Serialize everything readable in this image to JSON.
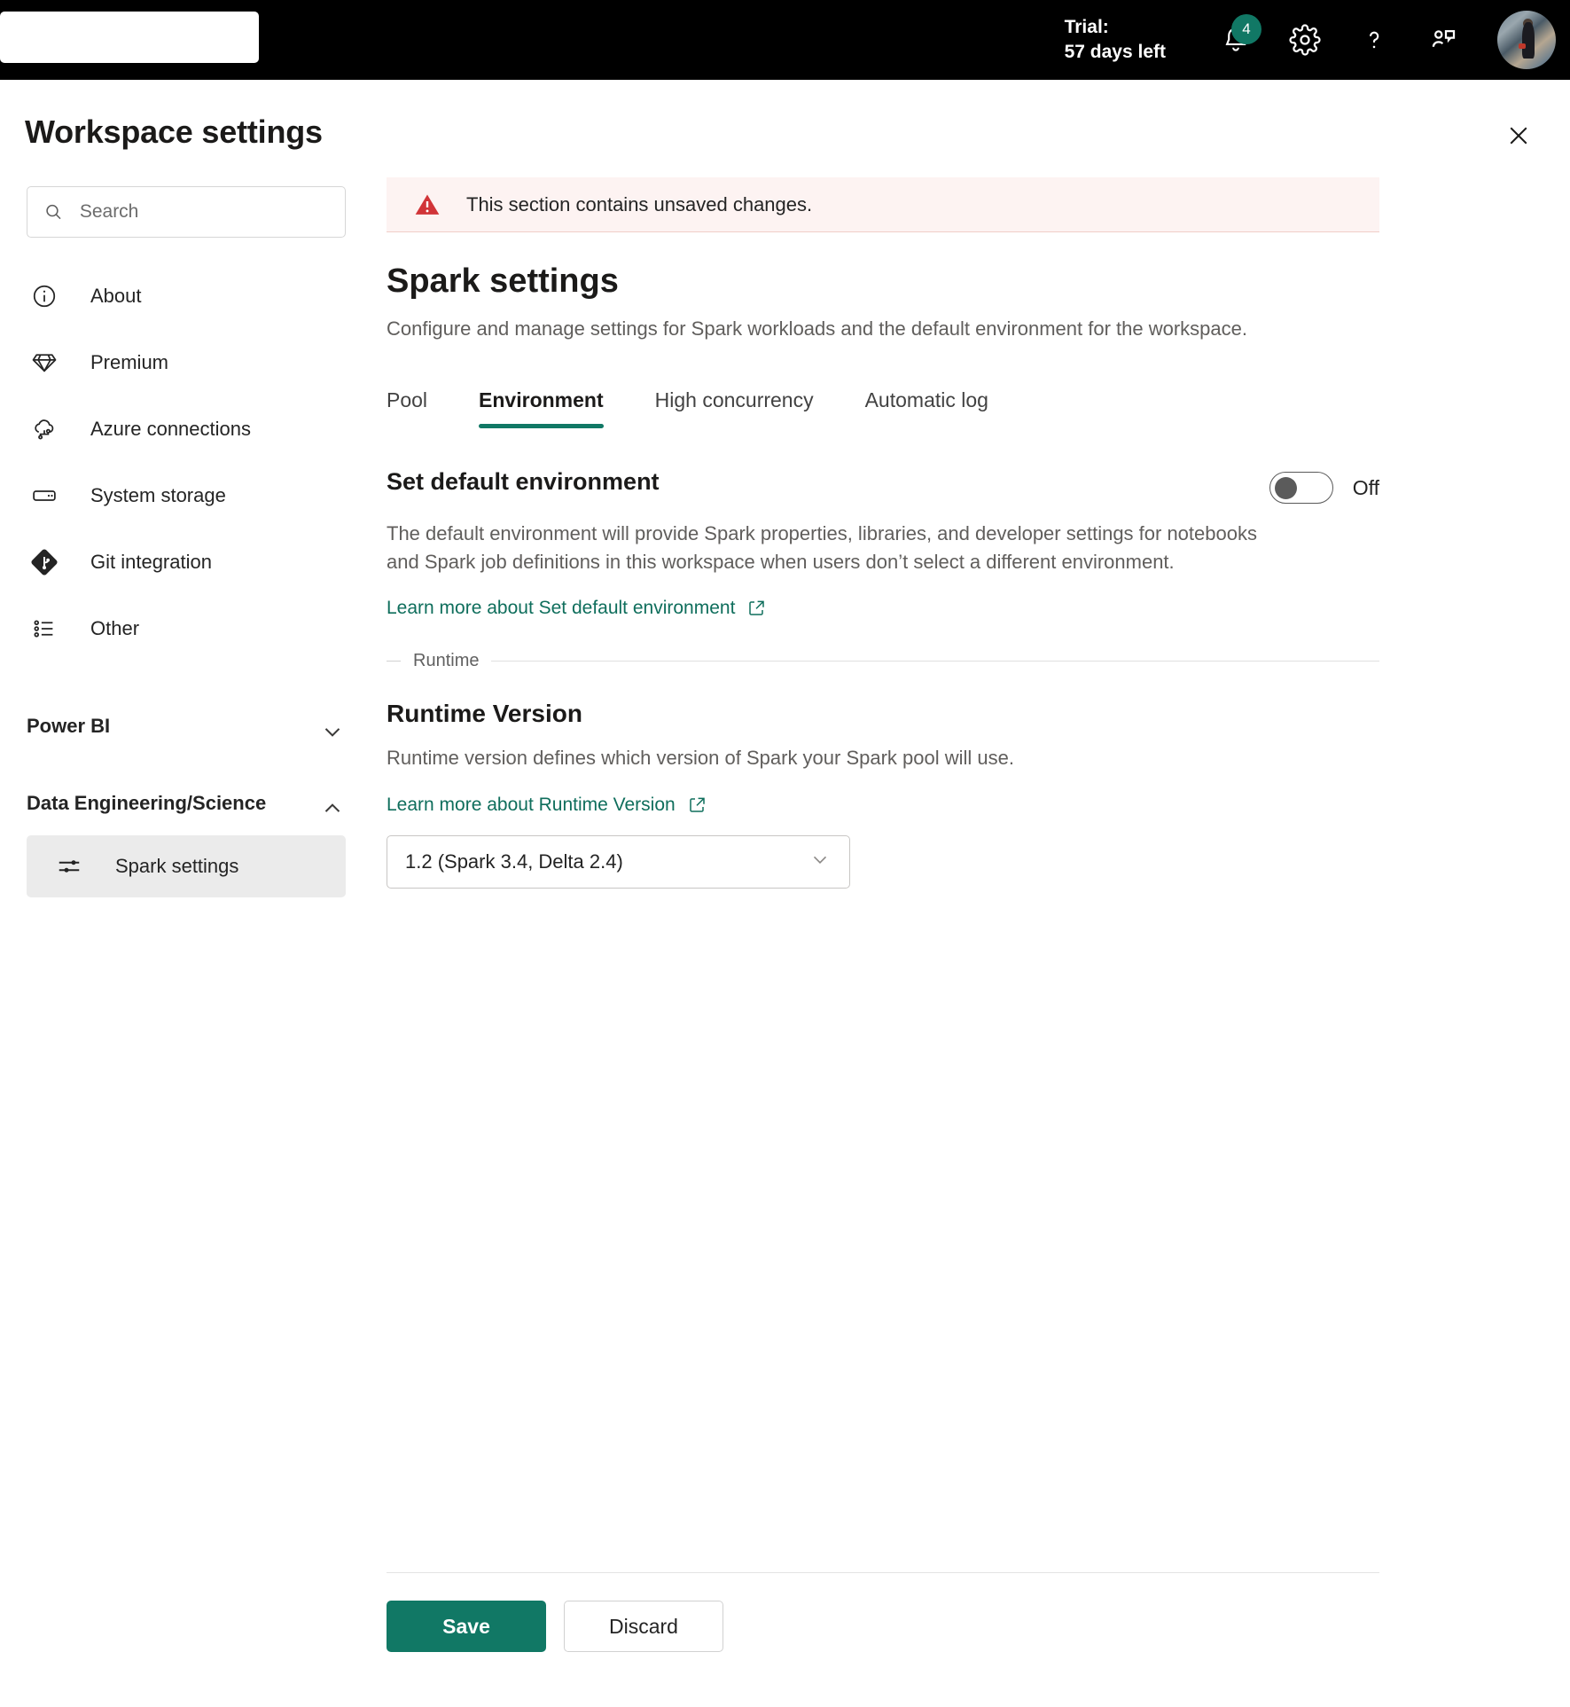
{
  "topbar": {
    "search_value": "",
    "search_placeholder": "",
    "trial_label": "Trial:",
    "trial_days": "57 days left",
    "notifications_icon": "bell-icon",
    "notification_count": "4",
    "settings_icon": "gear-icon",
    "help_icon": "question-mark-icon",
    "feedback_icon": "feedback-icon",
    "avatar_icon": "user-avatar",
    "accent_color": "#117865",
    "background_color": "#000000"
  },
  "panel": {
    "title": "Workspace settings",
    "close_icon": "close-icon"
  },
  "sidebar": {
    "search": {
      "placeholder": "Search",
      "value": "",
      "icon": "search-icon"
    },
    "items": [
      {
        "label": "About",
        "icon": "info-circle-icon"
      },
      {
        "label": "Premium",
        "icon": "diamond-icon"
      },
      {
        "label": "Azure connections",
        "icon": "cloud-connection-icon"
      },
      {
        "label": "System storage",
        "icon": "storage-icon"
      },
      {
        "label": "Git integration",
        "icon": "git-icon"
      },
      {
        "label": "Other",
        "icon": "list-icon"
      }
    ],
    "groups": [
      {
        "label": "Power BI",
        "chevron": "chevron-down-icon",
        "expanded": false,
        "children": []
      },
      {
        "label": "Data Engineering/Science",
        "chevron": "chevron-up-icon",
        "expanded": true,
        "children": [
          {
            "label": "Spark settings",
            "icon": "sliders-icon",
            "selected": true
          }
        ]
      }
    ]
  },
  "main": {
    "alert": {
      "icon": "warning-triangle-icon",
      "text": "This section contains unsaved changes.",
      "background_color": "#fdf3f2",
      "icon_color": "#d13438"
    },
    "heading": "Spark settings",
    "description": "Configure and manage settings for Spark workloads and the default environment for the workspace.",
    "tabs": [
      {
        "label": "Pool",
        "active": false
      },
      {
        "label": "Environment",
        "active": true
      },
      {
        "label": "High concurrency",
        "active": false
      },
      {
        "label": "Automatic log",
        "active": false
      }
    ],
    "default_environment": {
      "title": "Set default environment",
      "toggle_state": "Off",
      "toggle_on": false,
      "description": "The default environment will provide Spark properties, libraries, and developer settings for notebooks and Spark job definitions in this workspace when users don’t select a different environment.",
      "learn_more": "Learn more about Set default environment",
      "external_icon": "external-link-icon"
    },
    "runtime_divider": "Runtime",
    "runtime_version": {
      "title": "Runtime Version",
      "description": "Runtime version defines which version of Spark your Spark pool will use.",
      "learn_more": "Learn more about Runtime Version",
      "external_icon": "external-link-icon",
      "selected": "1.2 (Spark 3.4, Delta 2.4)",
      "chevron": "chevron-down-icon"
    }
  },
  "footer": {
    "save_label": "Save",
    "discard_label": "Discard"
  }
}
